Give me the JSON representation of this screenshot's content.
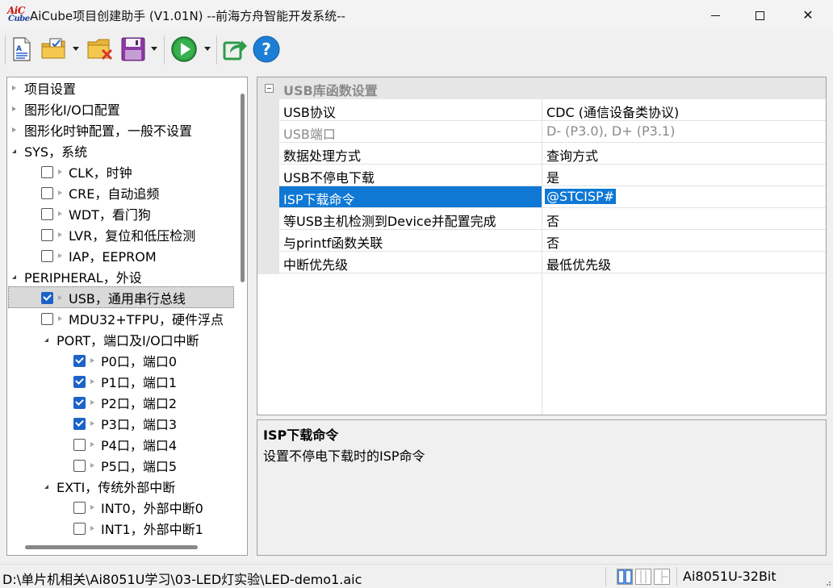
{
  "window": {
    "title": "AiCube项目创建助手 (V1.01N) --前海方舟智能开发系统--",
    "logo_line1": "AiC",
    "logo_line2": "Cube"
  },
  "toolbar": {
    "icons": [
      "new-document-icon",
      "open-project-icon",
      "close-project-icon",
      "save-icon",
      "run-icon",
      "export-icon",
      "help-icon"
    ],
    "help_glyph": "?"
  },
  "tree": {
    "items": [
      {
        "label": "项目设置",
        "kind": "leaf",
        "level": 0
      },
      {
        "label": "图形化I/O口配置",
        "kind": "leaf",
        "level": 0
      },
      {
        "label": "图形化时钟配置，一般不设置",
        "kind": "leaf",
        "level": 0
      },
      {
        "label": "SYS，系统",
        "kind": "group",
        "level": 0
      },
      {
        "label": "CLK，时钟",
        "kind": "check",
        "checked": false,
        "level": 1
      },
      {
        "label": "CRE，自动追频",
        "kind": "check",
        "checked": false,
        "level": 1
      },
      {
        "label": "WDT，看门狗",
        "kind": "check",
        "checked": false,
        "level": 1
      },
      {
        "label": "LVR，复位和低压检测",
        "kind": "check",
        "checked": false,
        "level": 1
      },
      {
        "label": "IAP，EEPROM",
        "kind": "check",
        "checked": false,
        "level": 1
      },
      {
        "label": "PERIPHERAL，外设",
        "kind": "group",
        "level": 0
      },
      {
        "label": "USB，通用串行总线",
        "kind": "check",
        "checked": true,
        "level": 1,
        "selected": true
      },
      {
        "label": "MDU32+TFPU，硬件浮点",
        "kind": "check",
        "checked": false,
        "level": 1
      },
      {
        "label": "PORT，端口及I/O口中断",
        "kind": "group",
        "level": 1
      },
      {
        "label": "P0口，端口0",
        "kind": "check",
        "checked": true,
        "level": 2
      },
      {
        "label": "P1口，端口1",
        "kind": "check",
        "checked": true,
        "level": 2
      },
      {
        "label": "P2口，端口2",
        "kind": "check",
        "checked": true,
        "level": 2
      },
      {
        "label": "P3口，端口3",
        "kind": "check",
        "checked": true,
        "level": 2
      },
      {
        "label": "P4口，端口4",
        "kind": "check",
        "checked": false,
        "level": 2
      },
      {
        "label": "P5口，端口5",
        "kind": "check",
        "checked": false,
        "level": 2
      },
      {
        "label": "EXTI，传统外部中断",
        "kind": "group",
        "level": 1
      },
      {
        "label": "INT0，外部中断0",
        "kind": "check",
        "checked": false,
        "level": 2
      },
      {
        "label": "INT1，外部中断1",
        "kind": "check",
        "checked": false,
        "level": 2
      }
    ]
  },
  "props": {
    "category": "USB库函数设置",
    "rows": [
      {
        "name": "USB协议",
        "value": "CDC (通信设备类协议)",
        "disabled": false,
        "selected": false
      },
      {
        "name": "USB端口",
        "value": "D- (P3.0), D+ (P3.1)",
        "disabled": true,
        "selected": false
      },
      {
        "name": "数据处理方式",
        "value": "查询方式",
        "disabled": false,
        "selected": false
      },
      {
        "name": "USB不停电下载",
        "value": "是",
        "disabled": false,
        "selected": false
      },
      {
        "name": "ISP下载命令",
        "value": "@STCISP#",
        "disabled": false,
        "selected": true
      },
      {
        "name": "等USB主机检测到Device并配置完成",
        "value": "否",
        "disabled": false,
        "selected": false
      },
      {
        "name": "与printf函数关联",
        "value": "否",
        "disabled": false,
        "selected": false
      },
      {
        "name": "中断优先级",
        "value": "最低优先级",
        "disabled": false,
        "selected": false
      }
    ]
  },
  "description": {
    "title": "ISP下载命令",
    "text": "设置不停电下载时的ISP命令"
  },
  "status": {
    "path": "D:\\单片机相关\\Ai8051U学习\\03-LED灯实验\\LED-demo1.aic",
    "chip": "Ai8051U-32Bit"
  },
  "colors": {
    "selection": "#0e78d4",
    "checkbox_checked": "#1d63c7",
    "run_green": "#2ea043",
    "help_blue": "#1c7ed6"
  }
}
